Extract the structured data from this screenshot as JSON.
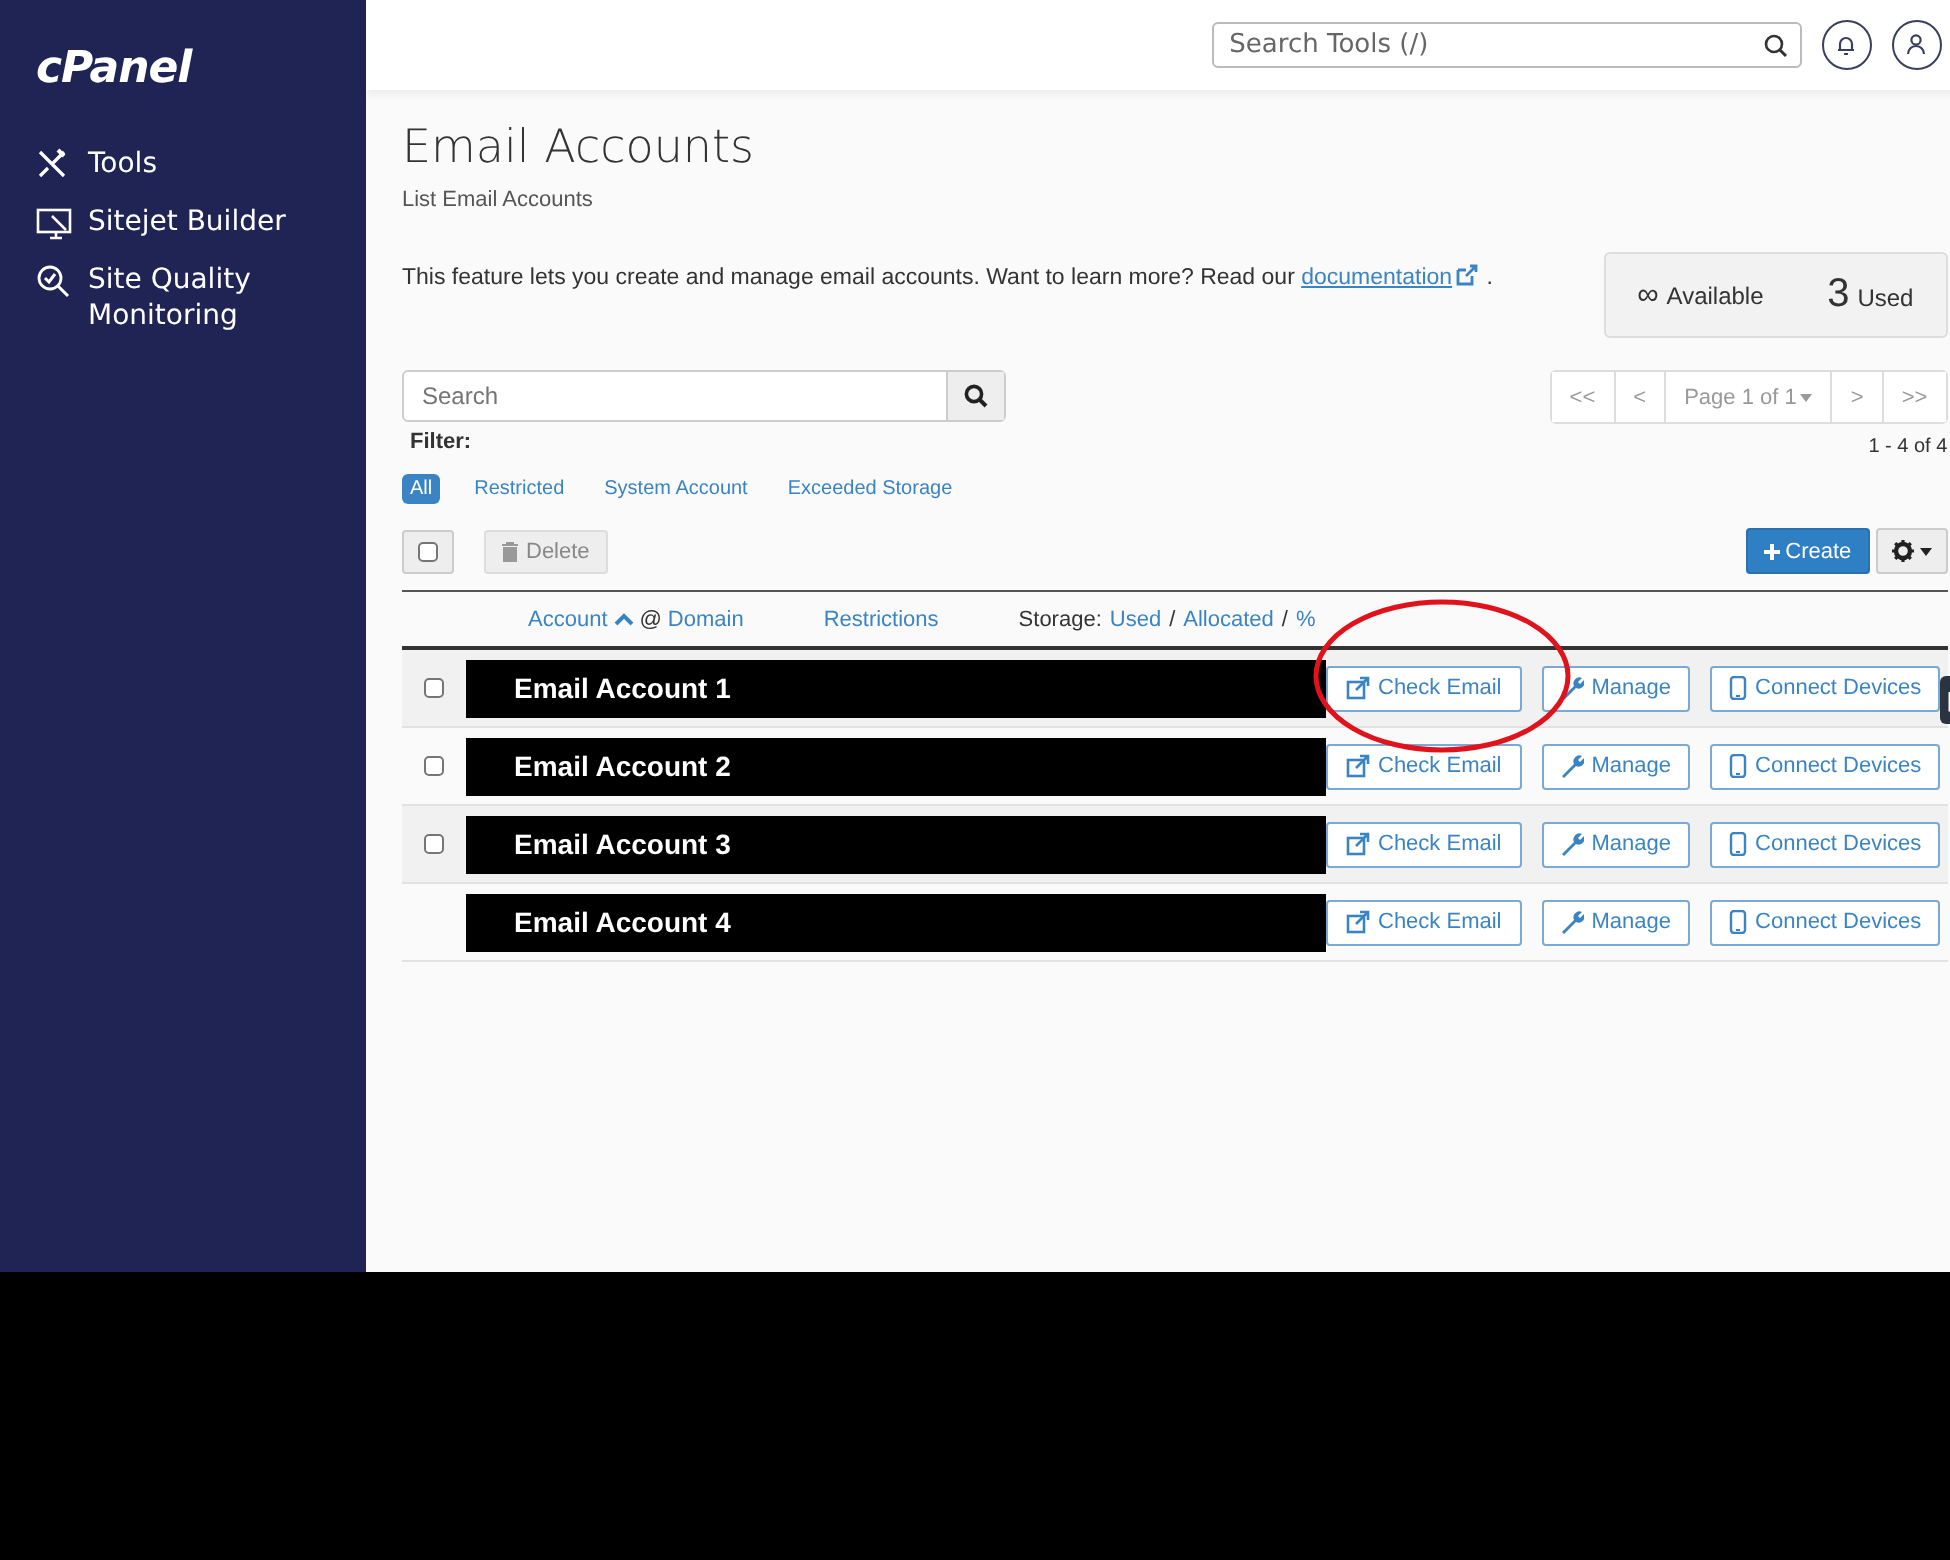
{
  "brand": {
    "logo": "cPanel"
  },
  "sidebar": {
    "items": [
      {
        "label": "Tools",
        "kind": "tools"
      },
      {
        "label": "Sitejet Builder",
        "kind": "monitor"
      },
      {
        "label": "Site Quality Monitoring",
        "kind": "magnifier"
      }
    ]
  },
  "header": {
    "search": {
      "placeholder": "Search Tools (/)"
    }
  },
  "page": {
    "title": "Email Accounts",
    "subtitle": "List Email Accounts",
    "intro": "This feature lets you create and manage email accounts. Want to learn more? Read our",
    "intro_link": "documentation",
    "intro_end": "."
  },
  "stats": [
    {
      "value": "∞",
      "label": "Available",
      "kind": "small"
    },
    {
      "value": "3",
      "label": "Used",
      "kind": "large"
    }
  ],
  "search": {
    "placeholder": "Search"
  },
  "pagination": {
    "buttons": [
      "<<",
      "<",
      "Page 1 of 1",
      ">",
      ">>"
    ],
    "range": "1 - 4 of 4"
  },
  "filter": {
    "label": "Filter:",
    "options": [
      {
        "label": "All",
        "selected": true
      },
      {
        "label": "Restricted",
        "selected": false
      },
      {
        "label": "System Account",
        "selected": false
      },
      {
        "label": "Exceeded Storage",
        "selected": false
      }
    ]
  },
  "toolbar": {
    "select_all": {
      "checked": false
    },
    "delete": "Delete",
    "create": "Create"
  },
  "columns": {
    "account": "Account",
    "at": "@",
    "domain": "Domain",
    "restrictions": "Restrictions",
    "storage_label": "Storage:",
    "storage": [
      {
        "text": "Used",
        "kind": "link"
      },
      {
        "text": "/",
        "kind": "sep"
      },
      {
        "text": "Allocated",
        "kind": "link"
      },
      {
        "text": "/",
        "kind": "sep"
      },
      {
        "text": "%",
        "kind": "link"
      }
    ]
  },
  "rows": [
    {
      "account": "Email Account 1",
      "kind": "regular",
      "checked": false,
      "actions": [
        "Check Email",
        "Manage",
        "Connect Devices"
      ]
    },
    {
      "account": "Email Account 2",
      "kind": "regular",
      "checked": false,
      "actions": [
        "Check Email",
        "Manage",
        "Connect Devices"
      ]
    },
    {
      "account": "Email Account 3",
      "kind": "regular",
      "checked": false,
      "actions": [
        "Check Email",
        "Manage",
        "Connect Devices"
      ]
    },
    {
      "account": "Email Account 4",
      "kind": "system",
      "actions": [
        "Check Email",
        "Manage",
        "Connect Devices"
      ]
    }
  ]
}
